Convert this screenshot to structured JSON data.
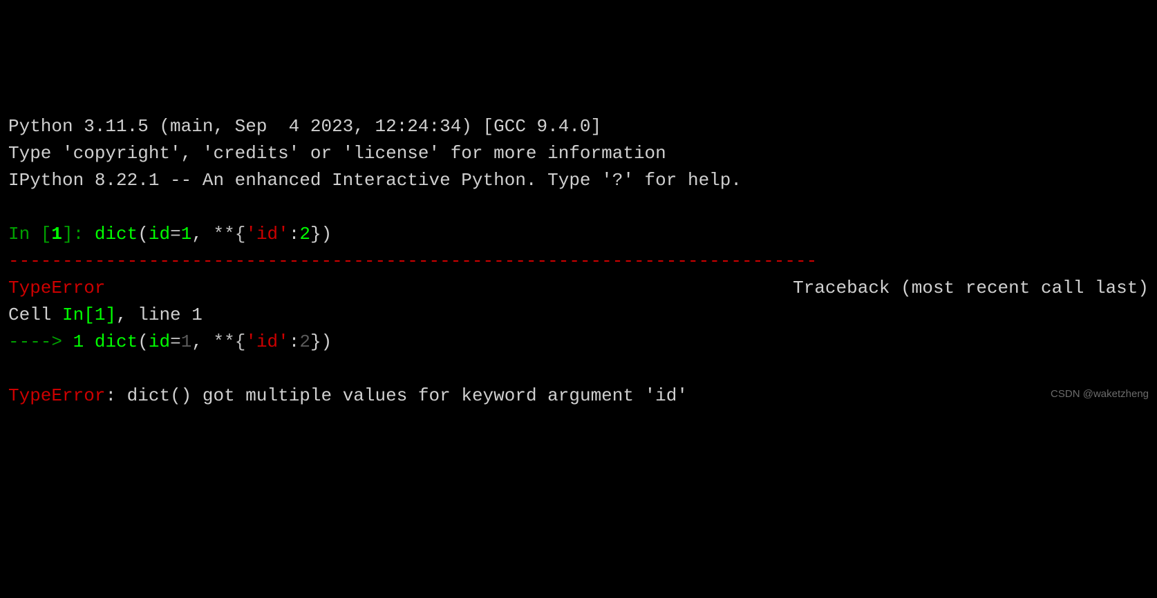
{
  "header": {
    "line1": "Python 3.11.5 (main, Sep  4 2023, 12:24:34) [GCC 9.4.0]",
    "line2": "Type 'copyright', 'credits' or 'license' for more information",
    "line3": "IPython 8.22.1 -- An enhanced Interactive Python. Type '?' for help."
  },
  "prompt": {
    "in_label": "In [",
    "in_num": "1",
    "in_close": "]: "
  },
  "code": {
    "func": "dict",
    "open_paren": "(",
    "arg_name": "id",
    "eq": "=",
    "arg_val": "1",
    "comma": ", ",
    "kwargs": "**{",
    "key": "'id'",
    "colon": ":",
    "val2": "2",
    "close": "})"
  },
  "traceback": {
    "dashes": "---------------------------------------------------------------------------",
    "error_name": "TypeError",
    "tb_label": "Traceback (most recent call last)",
    "cell_prefix": "Cell ",
    "in_bracket": "In[1]",
    "line_suffix": ", line 1",
    "arrow": "----> ",
    "line_no": "1 ",
    "error_msg_prefix": "TypeError",
    "error_msg_colon": ": ",
    "error_msg": "dict() got multiple values for keyword argument 'id'"
  },
  "watermark": "CSDN @waketzheng"
}
